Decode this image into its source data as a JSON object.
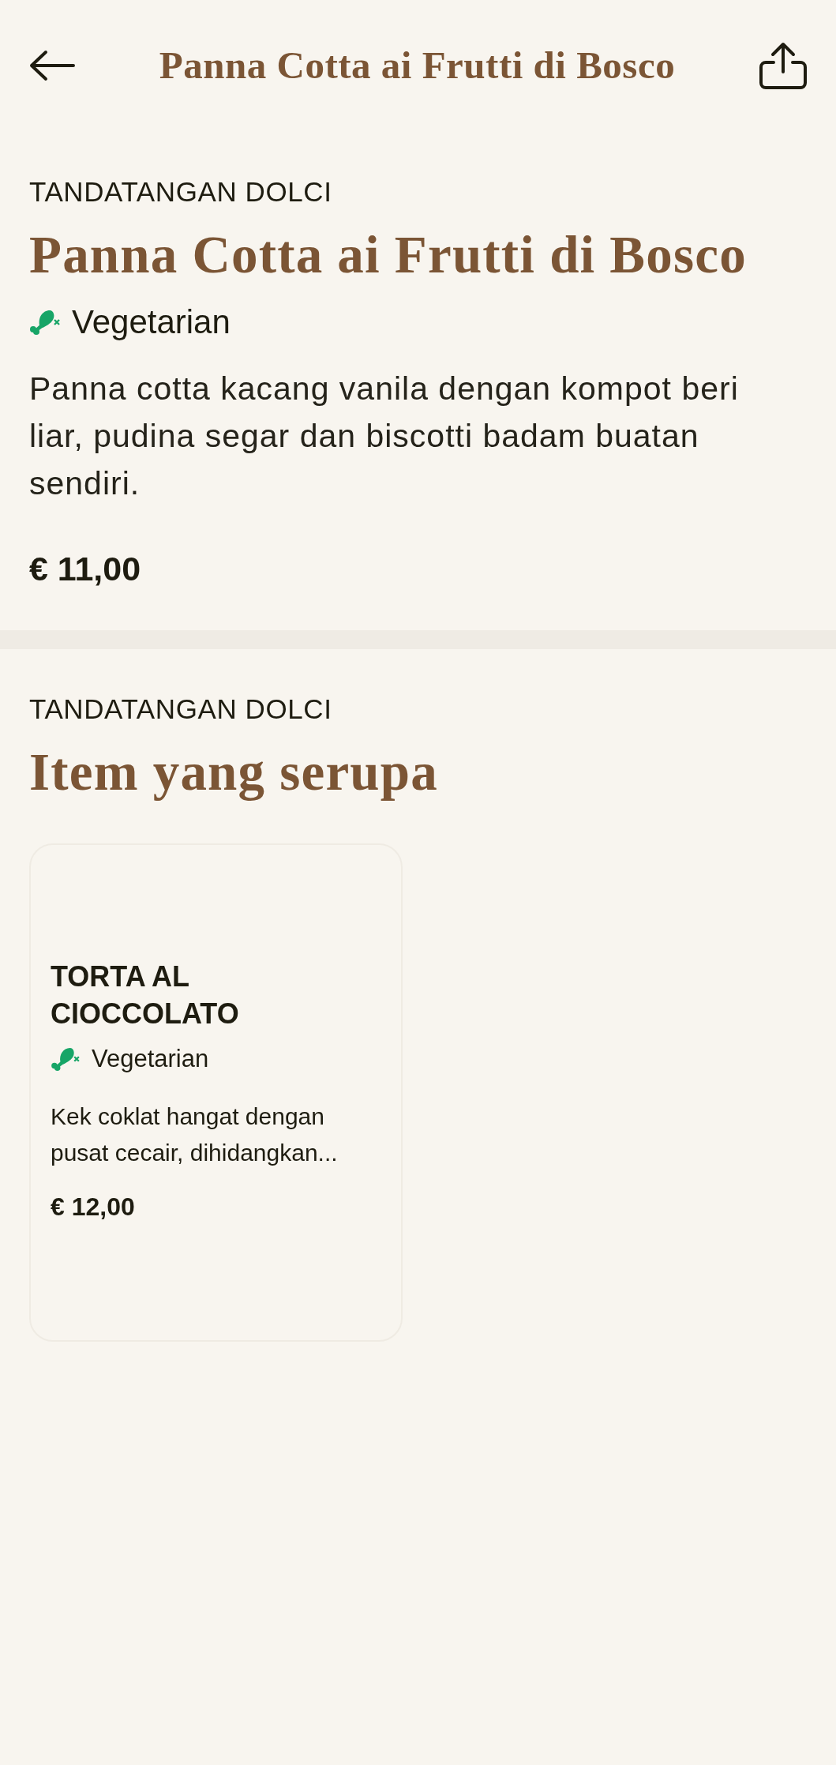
{
  "header": {
    "title": "Panna Cotta ai Frutti di Bosco"
  },
  "item": {
    "category": "TANDATANGAN DOLCI",
    "name": "Panna Cotta ai Frutti di Bosco",
    "tags": [
      {
        "kind": "vegetarian",
        "label": "Vegetarian"
      }
    ],
    "description": "Panna cotta kacang vanila dengan kompot beri liar, pudina segar dan biscotti badam buatan sendiri.",
    "price": "€ 11,00"
  },
  "similar": {
    "category": "TANDATANGAN DOLCI",
    "title": "Item yang serupa",
    "items": [
      {
        "name": "TORTA AL CIOCCOLATO",
        "tags": [
          {
            "kind": "vegetarian",
            "label": "Vegetarian"
          }
        ],
        "description": "Kek coklat hangat dengan pusat cecair, dihidangkan...",
        "price": "€ 12,00"
      }
    ]
  }
}
